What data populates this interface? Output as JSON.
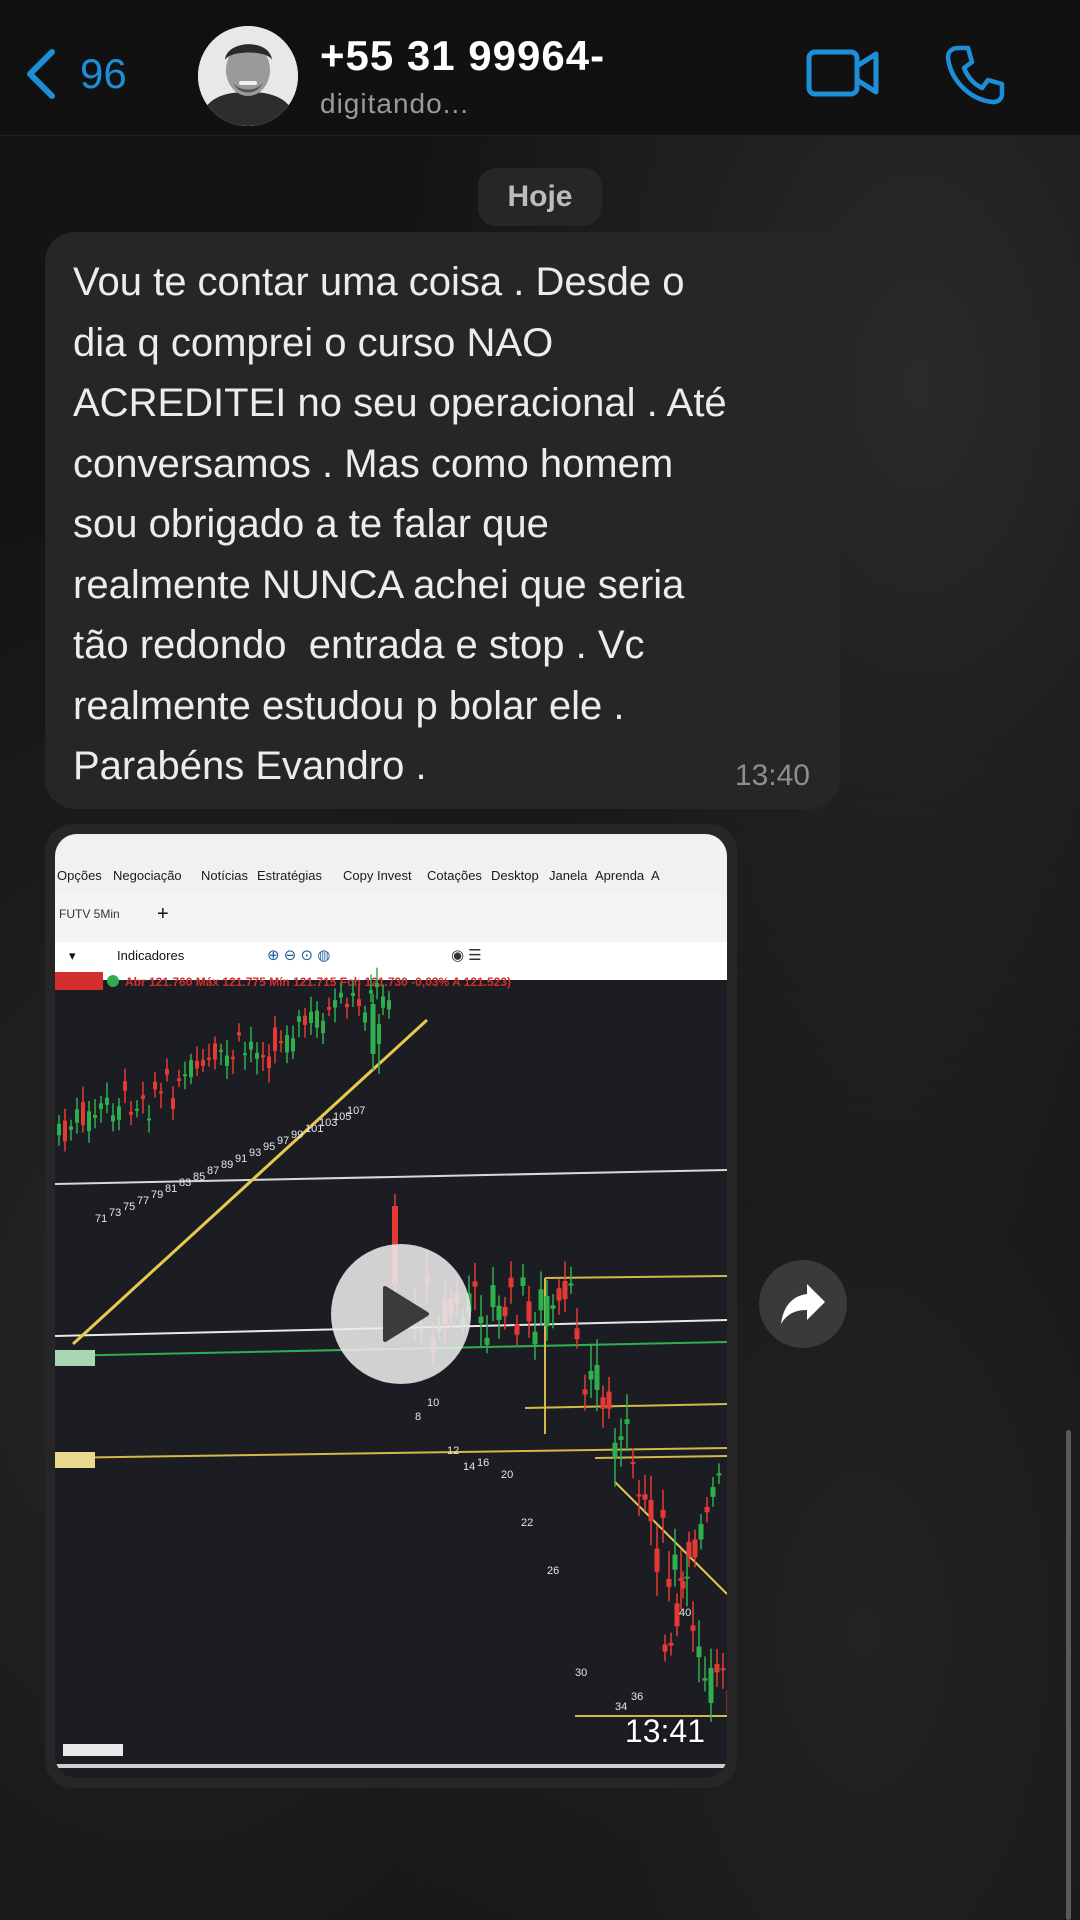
{
  "header": {
    "back_count": "96",
    "contact_name": "+55 31 99964-",
    "contact_status": "digitando..."
  },
  "date_chip": "Hoje",
  "message": {
    "text": "Vou te contar uma coisa . Desde o\ndia q comprei o curso NAO\nACREDITEI no seu operacional . Até\nconversamos . Mas como homem\nsou obrigado a te falar que\nrealmente NUNCA achei que seria\ntão redondo  entrada e stop . Vc\nrealmente estudou p bolar ele .\nParabéns Evandro .",
    "time": "13:40"
  },
  "video_message": {
    "time": "13:41",
    "screen": {
      "menu": [
        "Opções",
        "Negociação",
        "Notícias",
        "Estratégias",
        "Copy Invest",
        "Cotações",
        "Desktop",
        "Janela",
        "Aprenda",
        "A"
      ],
      "asset": "FUTV 5Min",
      "indicators_label": "Indicadores",
      "quote_line": "Abr 121.760 Máx 121.775 Mín 121.715 Fch 121.730 -0,03% A 121.523)",
      "labels_top": [
        "71",
        "73",
        "75",
        "77",
        "79",
        "81",
        "83",
        "85",
        "87",
        "89",
        "91",
        "93",
        "95",
        "97",
        "99",
        "101",
        "103",
        "105",
        "107"
      ],
      "labels_bottom": [
        "8",
        "10",
        "12",
        "14",
        "16",
        "20",
        "22",
        "26",
        "30",
        "34",
        "36",
        "40"
      ]
    }
  },
  "colors": {
    "accent": "#1c8fd8",
    "bubble": "#262626",
    "background": "#141414"
  },
  "icons": {
    "back": "chevron-left-icon",
    "video": "video-camera-icon",
    "call": "phone-icon",
    "play": "play-icon",
    "forward": "forward-arrow-icon"
  }
}
